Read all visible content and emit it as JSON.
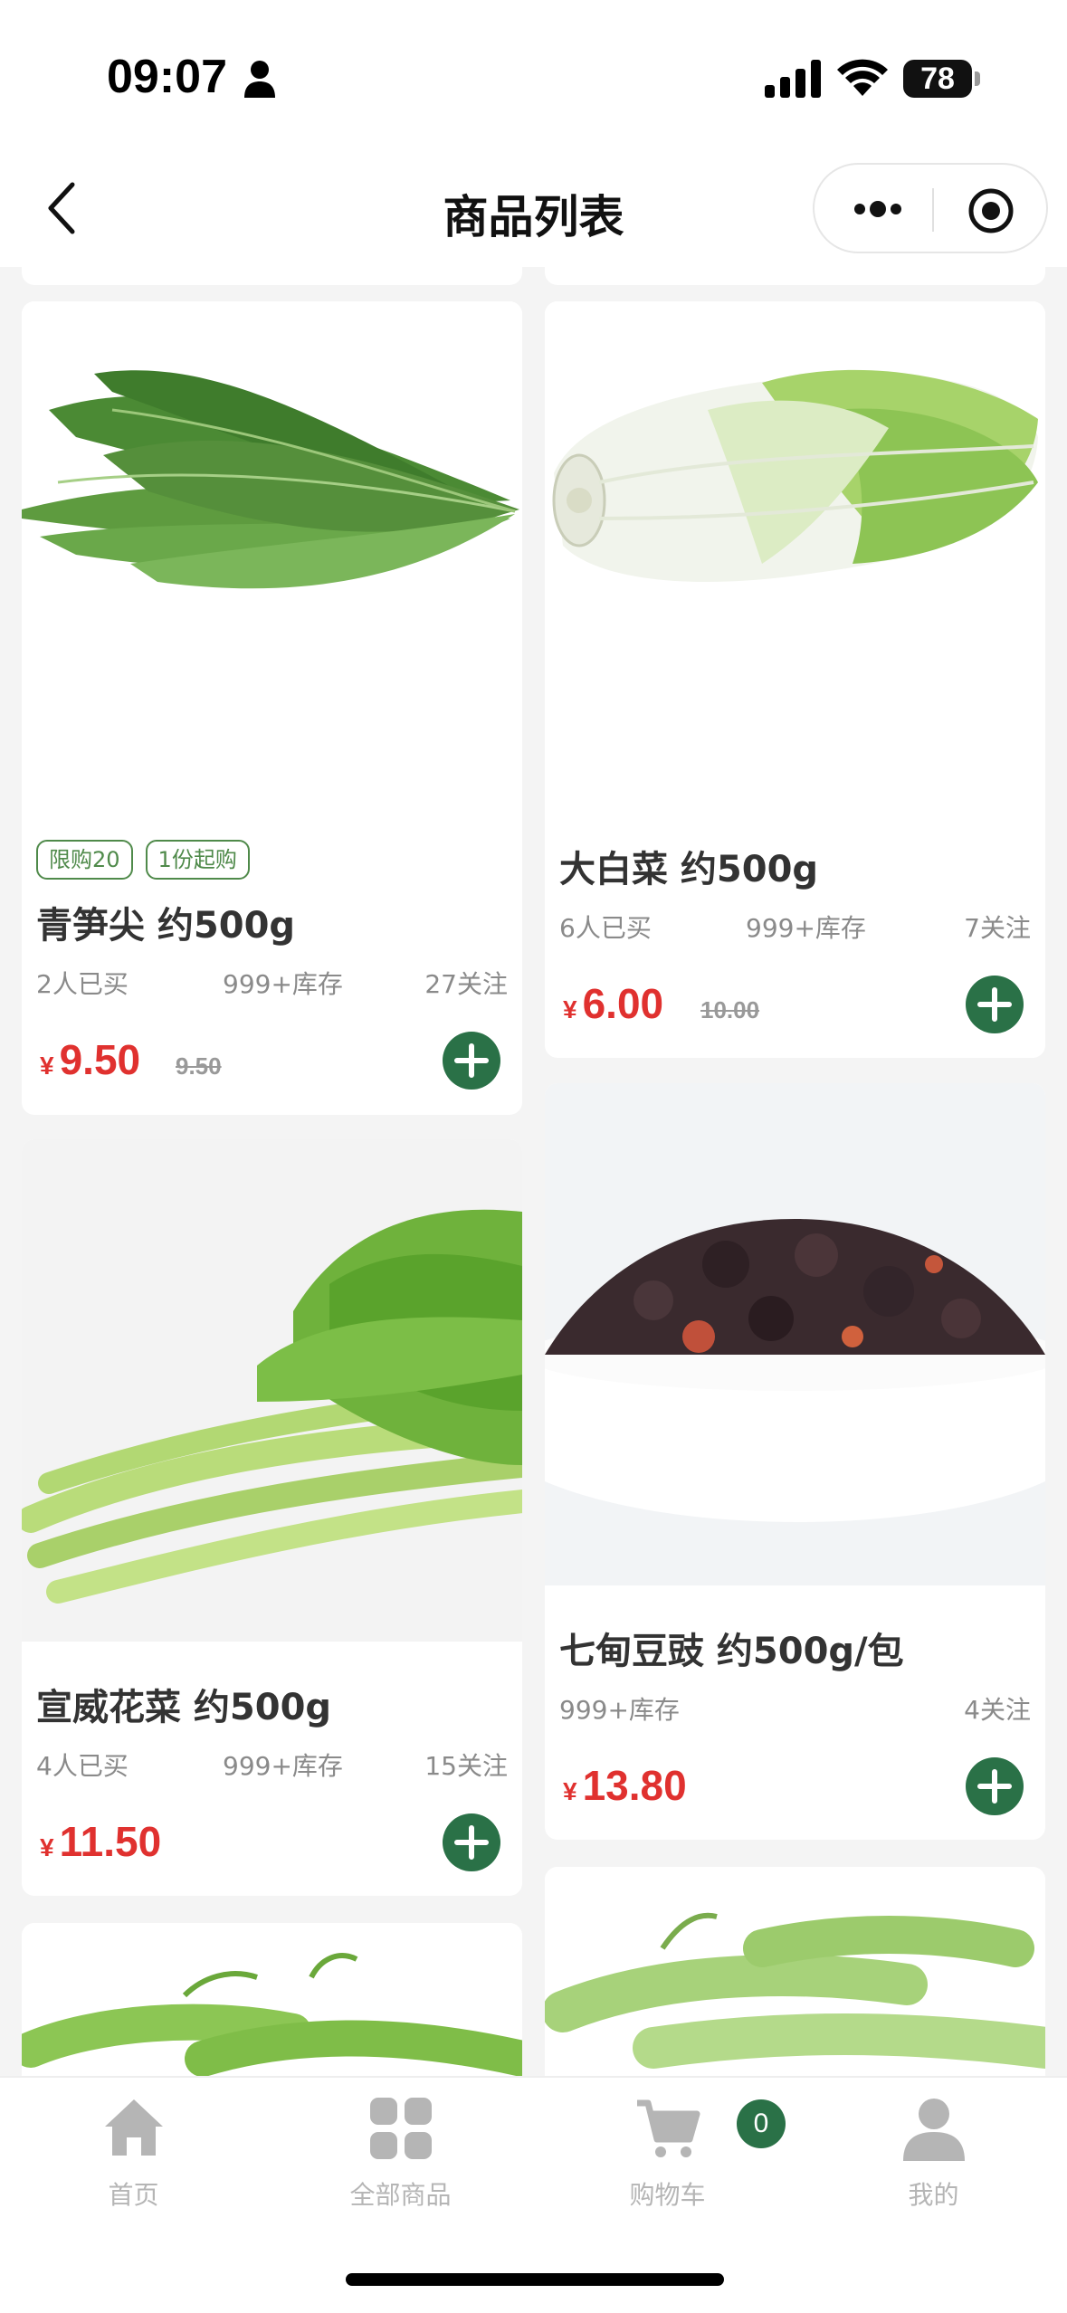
{
  "status_bar": {
    "time": "09:07",
    "battery": "78"
  },
  "nav": {
    "title": "商品列表"
  },
  "products": [
    {
      "name": "青笋尖 约500g",
      "tags": [
        "限购20",
        "1份起购"
      ],
      "bought": "2人已买",
      "stock": "999+库存",
      "follows": "27关注",
      "currency": "¥",
      "price": "9.50",
      "original_price": "9.50"
    },
    {
      "name": "大白菜 约500g",
      "tags": [],
      "bought": "6人已买",
      "stock": "999+库存",
      "follows": "7关注",
      "currency": "¥",
      "price": "6.00",
      "original_price": "10.00"
    },
    {
      "name": "宣威花菜 约500g",
      "tags": [],
      "bought": "4人已买",
      "stock": "999+库存",
      "follows": "15关注",
      "currency": "¥",
      "price": "11.50",
      "original_price": ""
    },
    {
      "name": "七甸豆豉 约500g/包",
      "tags": [],
      "bought": "",
      "stock": "999+库存",
      "follows": "4关注",
      "currency": "¥",
      "price": "13.80",
      "original_price": ""
    }
  ],
  "tab_bar": {
    "items": [
      {
        "label": "首页",
        "icon": "home-icon"
      },
      {
        "label": "全部商品",
        "icon": "grid-icon"
      },
      {
        "label": "购物车",
        "icon": "cart-icon"
      },
      {
        "label": "我的",
        "icon": "user-icon"
      }
    ],
    "cart_count": "0"
  },
  "colors": {
    "accent": "#2a7147",
    "price": "#e0312f",
    "tag": "#4f8a4a",
    "tab_inactive": "#b5b5b5"
  }
}
